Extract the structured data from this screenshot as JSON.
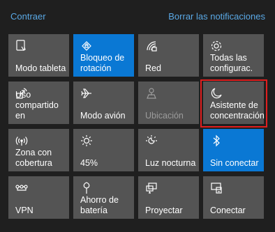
{
  "header": {
    "collapse_label": "Contraer",
    "clear_label": "Borrar las notificaciones"
  },
  "tiles": [
    {
      "label": "Modo tableta",
      "icon": "tablet-mode-icon",
      "state": "off"
    },
    {
      "label": "Bloqueo de\nrotación",
      "icon": "rotation-lock-icon",
      "state": "on"
    },
    {
      "label": "Red",
      "icon": "network-icon",
      "state": "off"
    },
    {
      "label": "Todas las\nconfigurac.",
      "icon": "gear-icon",
      "state": "off"
    },
    {
      "label": "Uso\ncompartido en",
      "icon": "nearby-sharing-icon",
      "state": "off"
    },
    {
      "label": "Modo avión",
      "icon": "airplane-icon",
      "state": "off"
    },
    {
      "label": "Ubicación",
      "icon": "location-icon",
      "state": "disabled"
    },
    {
      "label": "Asistente de\nconcentración",
      "icon": "moon-icon",
      "state": "off"
    },
    {
      "label": "Zona con\ncobertura",
      "icon": "mobile-hotspot-icon",
      "state": "off"
    },
    {
      "label": "45%",
      "icon": "brightness-icon",
      "state": "off"
    },
    {
      "label": "Luz nocturna",
      "icon": "night-light-icon",
      "state": "off"
    },
    {
      "label": "Sin conectar",
      "icon": "bluetooth-icon",
      "state": "on"
    },
    {
      "label": "VPN",
      "icon": "vpn-icon",
      "state": "off"
    },
    {
      "label": "Ahorro de\nbatería",
      "icon": "battery-saver-icon",
      "state": "off"
    },
    {
      "label": "Proyectar",
      "icon": "project-icon",
      "state": "off"
    },
    {
      "label": "Conectar",
      "icon": "connect-icon",
      "state": "off"
    }
  ],
  "colors": {
    "background": "#1f1f1f",
    "tile": "#545454",
    "tile_active": "#0a78d4",
    "link": "#5aa9e6",
    "highlight": "#e01e1e"
  }
}
